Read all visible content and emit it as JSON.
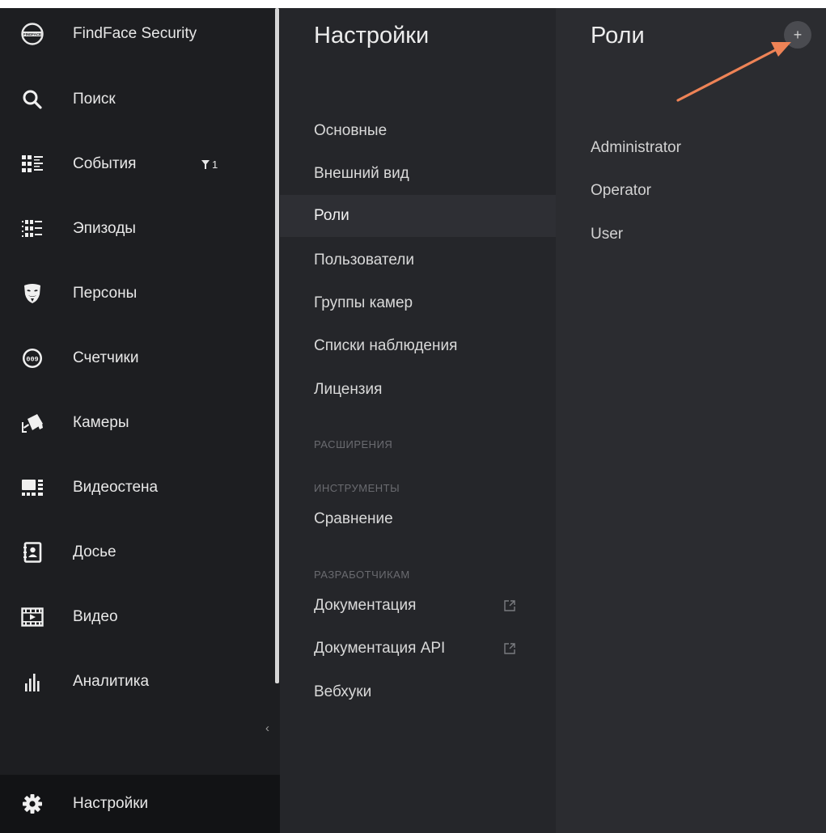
{
  "sidebar": {
    "brand": {
      "label": "FindFace Security",
      "logo_text": "FINDFACE"
    },
    "items": [
      {
        "label": "Поиск",
        "icon": "search-icon"
      },
      {
        "label": "События",
        "icon": "events-grid-icon",
        "filter_count": "1"
      },
      {
        "label": "Эпизоды",
        "icon": "episodes-icon"
      },
      {
        "label": "Персоны",
        "icon": "person-mask-icon"
      },
      {
        "label": "Счетчики",
        "icon": "counter-icon",
        "icon_text": "009"
      },
      {
        "label": "Камеры",
        "icon": "camera-icon"
      },
      {
        "label": "Видеостена",
        "icon": "videowall-icon"
      },
      {
        "label": "Досье",
        "icon": "dossier-icon"
      },
      {
        "label": "Видео",
        "icon": "video-icon"
      },
      {
        "label": "Аналитика",
        "icon": "analytics-icon"
      }
    ],
    "collapse_symbol": "‹",
    "settings": {
      "label": "Настройки",
      "icon": "gear-icon"
    }
  },
  "settings_menu": {
    "title": "Настройки",
    "items": [
      "Основные",
      "Внешний вид",
      "Роли",
      "Пользователи",
      "Группы камер",
      "Списки наблюдения",
      "Лицензия"
    ],
    "active": "Роли",
    "sections": {
      "extensions": "РАСШИРЕНИЯ",
      "tools": "ИНСТРУМЕНТЫ",
      "developers": "РАЗРАБОТЧИКАМ"
    },
    "tools_items": [
      "Сравнение"
    ],
    "developer_items": [
      {
        "label": "Документация",
        "external": true
      },
      {
        "label": "Документация API",
        "external": true
      },
      {
        "label": "Вебхуки",
        "external": false
      }
    ]
  },
  "roles_panel": {
    "title": "Роли",
    "add_symbol": "+",
    "roles": [
      "Administrator",
      "Operator",
      "User"
    ]
  },
  "colors": {
    "arrow": "#ee8356",
    "sidebar_bg": "#1d1e21",
    "menu_bg": "#25262a",
    "panel_bg": "#2b2c30"
  }
}
